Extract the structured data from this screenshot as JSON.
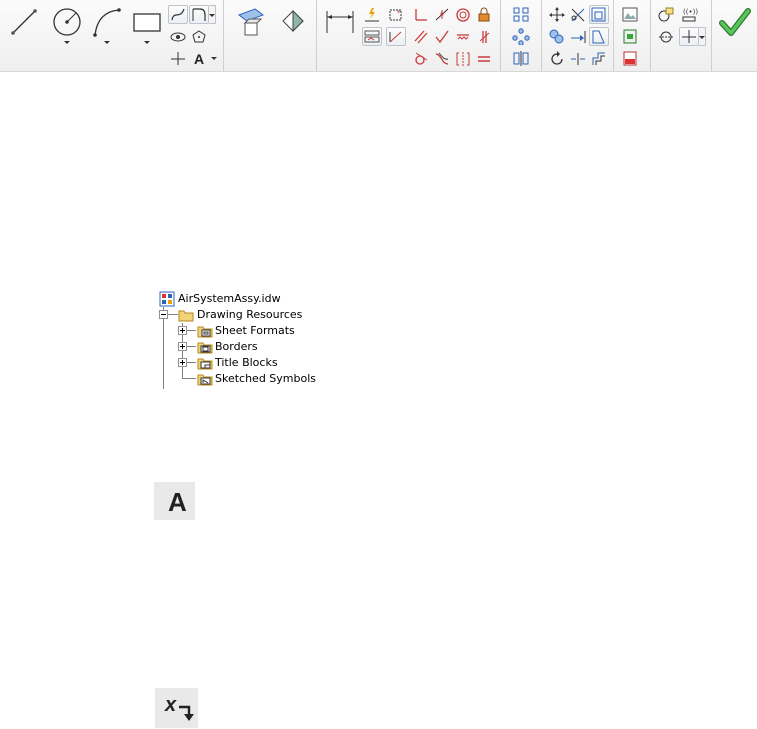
{
  "ribbon": {
    "groups": [
      {
        "name": "draw"
      },
      {
        "name": "pattern"
      },
      {
        "name": "constrain"
      },
      {
        "name": "layout"
      },
      {
        "name": "modify"
      },
      {
        "name": "insert"
      },
      {
        "name": "format"
      },
      {
        "name": "exit"
      }
    ],
    "colors": {
      "constraint_red": "#c83a3a",
      "accent_blue": "#2e63b8",
      "finish_green": "#3aa43a"
    }
  },
  "tree": {
    "root": {
      "label": "AirSystemAssy.idw",
      "icon": "drawing-document-icon"
    },
    "folder": {
      "label": "Drawing Resources",
      "icon": "folder-icon",
      "expanded": true
    },
    "children": [
      {
        "label": "Sheet Formats",
        "icon": "sheet-formats-icon",
        "expanded": false
      },
      {
        "label": "Borders",
        "icon": "borders-icon",
        "expanded": false
      },
      {
        "label": "Title Blocks",
        "icon": "title-blocks-icon",
        "expanded": false
      },
      {
        "label": "Sketched Symbols",
        "icon": "sketched-symbols-icon",
        "expanded": false
      }
    ]
  },
  "tiles": [
    {
      "name": "text-tool-glyph",
      "glyph": "A"
    },
    {
      "name": "insert-variable-glyph",
      "glyph": "x"
    }
  ]
}
